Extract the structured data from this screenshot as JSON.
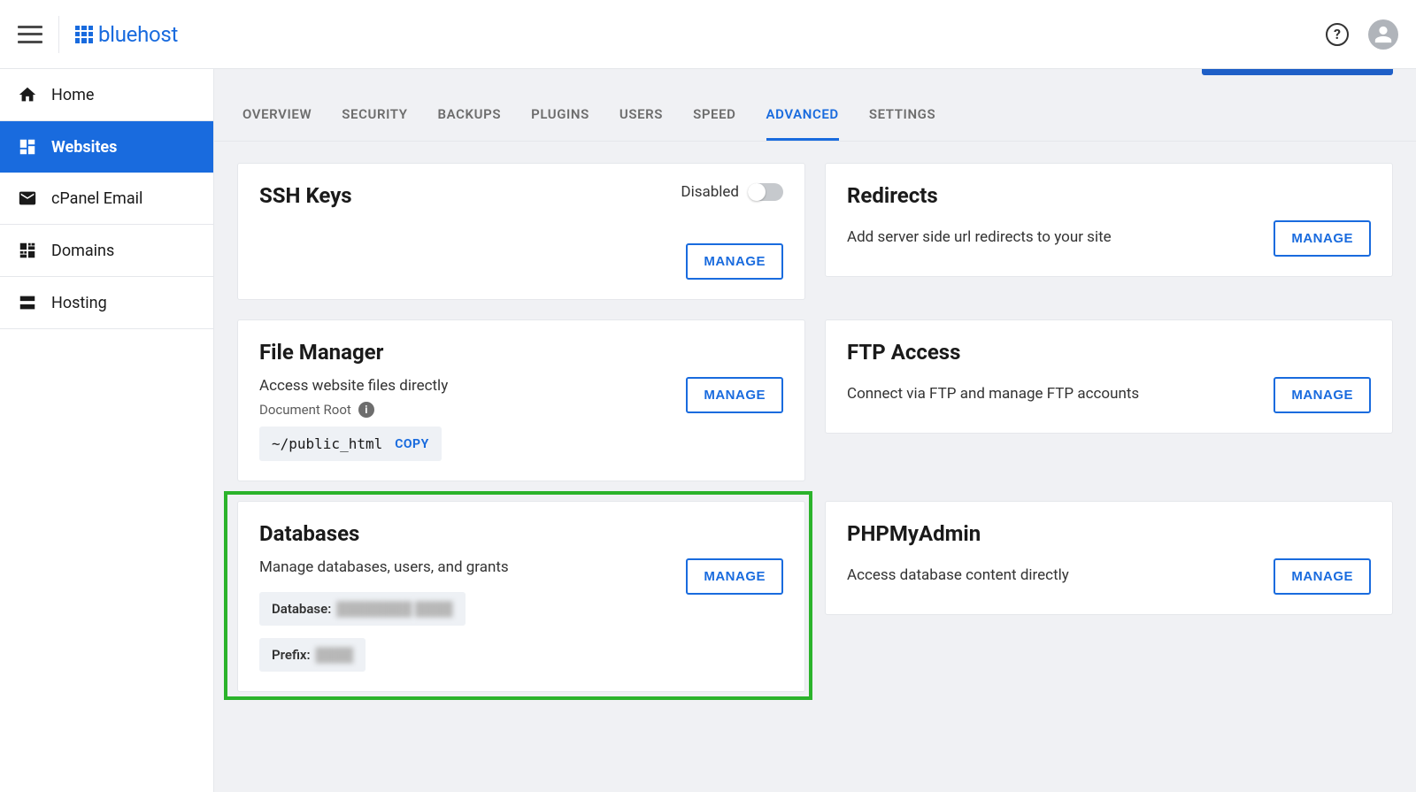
{
  "brand": "bluehost",
  "sidebar": {
    "items": [
      {
        "label": "Home"
      },
      {
        "label": "Websites"
      },
      {
        "label": "cPanel Email"
      },
      {
        "label": "Domains"
      },
      {
        "label": "Hosting"
      }
    ]
  },
  "tabs": {
    "items": [
      {
        "label": "OVERVIEW"
      },
      {
        "label": "SECURITY"
      },
      {
        "label": "BACKUPS"
      },
      {
        "label": "PLUGINS"
      },
      {
        "label": "USERS"
      },
      {
        "label": "SPEED"
      },
      {
        "label": "ADVANCED"
      },
      {
        "label": "SETTINGS"
      }
    ]
  },
  "cards": {
    "ssh": {
      "title": "SSH Keys",
      "toggle_label": "Disabled",
      "manage": "MANAGE"
    },
    "redirects": {
      "title": "Redirects",
      "desc": "Add server side url redirects to your site",
      "manage": "MANAGE"
    },
    "file_manager": {
      "title": "File Manager",
      "desc": "Access website files directly",
      "docroot_label": "Document Root",
      "docroot_value": "~/public_html",
      "copy_label": "COPY",
      "manage": "MANAGE"
    },
    "ftp": {
      "title": "FTP Access",
      "desc": "Connect via FTP and manage FTP accounts",
      "manage": "MANAGE"
    },
    "databases": {
      "title": "Databases",
      "desc": "Manage databases, users, and grants",
      "db_label": "Database:",
      "db_value": "████████ ████",
      "prefix_label": "Prefix:",
      "prefix_value": "████",
      "manage": "MANAGE"
    },
    "phpmyadmin": {
      "title": "PHPMyAdmin",
      "desc": "Access database content directly",
      "manage": "MANAGE"
    }
  }
}
